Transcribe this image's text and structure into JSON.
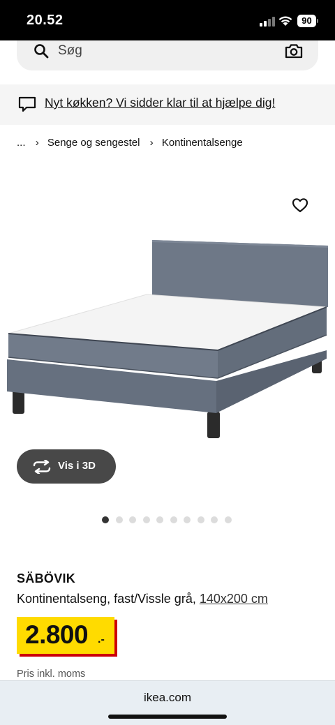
{
  "status_bar": {
    "time": "20.52",
    "battery": "90"
  },
  "search": {
    "placeholder": "Søg"
  },
  "help_banner": {
    "text": "Nyt køkken? Vi sidder klar til at hjælpe dig!"
  },
  "breadcrumb": {
    "ellipsis": "...",
    "items": [
      "Senge og sengestel",
      "Kontinentalsenge"
    ]
  },
  "gallery": {
    "view_3d_label": "Vis i 3D",
    "dot_count": 10,
    "active_dot": 0
  },
  "product": {
    "name": "SÄBÖVIK",
    "description": "Kontinentalseng, fast/Vissle grå,",
    "size": "140x200 cm",
    "price": "2.800",
    "price_suffix": ".-",
    "vat_note": "Pris inkl. moms"
  },
  "browser": {
    "url": "ikea.com"
  },
  "colors": {
    "price_yellow": "#ffdb00",
    "price_red": "#cc0008",
    "button_dark": "#484848"
  },
  "icons": [
    "search-icon",
    "camera-icon",
    "chat-icon",
    "heart-icon",
    "rotate-3d-icon"
  ]
}
